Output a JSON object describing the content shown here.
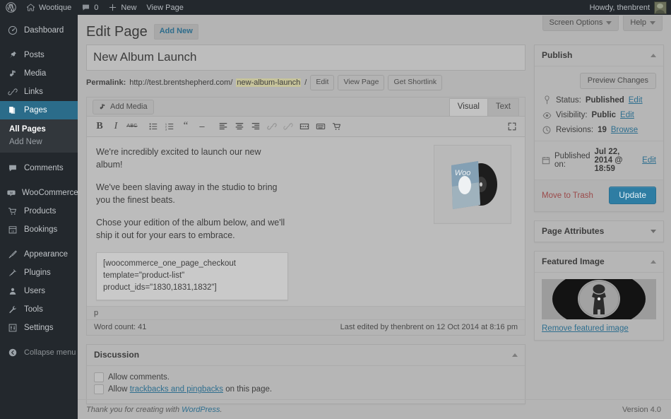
{
  "adminbar": {
    "logo_icon": "wordpress-logo-icon",
    "site_name": "Wootique",
    "site_icon": "home-icon",
    "comments_icon": "comment-bubble-icon",
    "comments_count": "0",
    "new_icon": "plus-icon",
    "new_label": "New",
    "view_page_label": "View Page",
    "howdy": "Howdy, thenbrent",
    "avatar_name": "user-avatar"
  },
  "sidebar": {
    "items": [
      {
        "label": "Dashboard",
        "icon": "dashboard-icon",
        "key": "dashboard",
        "current": false
      },
      {
        "label": "Posts",
        "icon": "pin-icon",
        "key": "posts",
        "current": false
      },
      {
        "label": "Media",
        "icon": "media-icon",
        "key": "media",
        "current": false
      },
      {
        "label": "Links",
        "icon": "link-icon",
        "key": "links",
        "current": false
      },
      {
        "label": "Pages",
        "icon": "page-icon",
        "key": "pages",
        "current": true
      },
      {
        "label": "Comments",
        "icon": "comment-bubble-icon",
        "key": "comments",
        "current": false
      },
      {
        "label": "WooCommerce",
        "icon": "woocommerce-icon",
        "key": "woocommerce",
        "current": false
      },
      {
        "label": "Products",
        "icon": "cart-icon",
        "key": "products",
        "current": false
      },
      {
        "label": "Bookings",
        "icon": "calendar-icon",
        "key": "bookings",
        "current": false
      },
      {
        "label": "Appearance",
        "icon": "brush-icon",
        "key": "appearance",
        "current": false
      },
      {
        "label": "Plugins",
        "icon": "plug-icon",
        "key": "plugins",
        "current": false
      },
      {
        "label": "Users",
        "icon": "user-icon",
        "key": "users",
        "current": false
      },
      {
        "label": "Tools",
        "icon": "wrench-icon",
        "key": "tools",
        "current": false
      },
      {
        "label": "Settings",
        "icon": "settings-icon",
        "key": "settings",
        "current": false
      }
    ],
    "submenu": {
      "all_pages": "All Pages",
      "add_new": "Add New"
    },
    "collapse": {
      "label": "Collapse menu",
      "icon": "collapse-arrow-icon"
    },
    "active_color": "#2b6c8a"
  },
  "screen_meta": {
    "screen_options": "Screen Options",
    "help": "Help"
  },
  "header": {
    "title": "Edit Page",
    "add_new": "Add New"
  },
  "post": {
    "title": "New Album Launch",
    "title_placeholder": "Enter title here",
    "permalink": {
      "label": "Permalink:",
      "base_url": "http://test.brentshepherd.com/",
      "slug": "new-album-launch",
      "slug_suffix": "/",
      "edit_button": "Edit",
      "view_button": "View Page",
      "shortlink_button": "Get Shortlink"
    },
    "editor": {
      "add_media": "Add Media",
      "add_media_icon": "add-media-icon",
      "tabs": [
        {
          "label": "Visual",
          "active": true
        },
        {
          "label": "Text",
          "active": false
        }
      ],
      "toolbar": [
        {
          "name": "bold-icon",
          "glyph": "B"
        },
        {
          "name": "italic-icon",
          "glyph": "I"
        },
        {
          "name": "strikethrough-icon",
          "glyph": "ABC"
        },
        {
          "name": "bulleted-list-icon",
          "glyph": ""
        },
        {
          "name": "numbered-list-icon",
          "glyph": ""
        },
        {
          "name": "blockquote-icon",
          "glyph": "“"
        },
        {
          "name": "horizontal-rule-icon",
          "glyph": "—"
        },
        {
          "name": "align-left-icon",
          "glyph": ""
        },
        {
          "name": "align-center-icon",
          "glyph": ""
        },
        {
          "name": "align-right-icon",
          "glyph": ""
        },
        {
          "name": "insert-link-icon",
          "glyph": ""
        },
        {
          "name": "unlink-icon",
          "glyph": ""
        },
        {
          "name": "read-more-icon",
          "glyph": ""
        },
        {
          "name": "kitchen-sink-icon",
          "glyph": ""
        },
        {
          "name": "woocommerce-shortcode-cart-icon",
          "glyph": ""
        }
      ],
      "fullscreen_icon": "distraction-free-icon",
      "paragraphs": [
        "We're incredibly excited to launch our new album!",
        "We've been slaving away in the studio to bring you the finest beats.",
        "Chose your edition of the album below, and we'll ship it out for your ears to embrace."
      ],
      "shortcode": "[woocommerce_one_page_checkout template=\"product-list\" product_ids=\"1830,1831,1832\"]",
      "inline_image_alt": "album-cover-woo-vinyl",
      "inline_image_label": "Woo",
      "path": "p",
      "word_count": "Word count: 41",
      "last_edited": "Last edited by thenbrent on 12 Oct 2014 at 8:16 pm"
    },
    "discussion": {
      "title": "Discussion",
      "allow_comments": "Allow comments.",
      "allow_trackbacks_prefix": "Allow ",
      "allow_trackbacks_link": "trackbacks and pingbacks",
      "allow_trackbacks_suffix": " on this page.",
      "comments_checked": false,
      "trackbacks_checked": false
    }
  },
  "publish": {
    "title": "Publish",
    "preview_button": "Preview Changes",
    "status_icon": "pin-marker-icon",
    "status_label": "Status:",
    "status_value": "Published",
    "status_edit": "Edit",
    "visibility_icon": "eye-icon",
    "visibility_label": "Visibility:",
    "visibility_value": "Public",
    "visibility_edit": "Edit",
    "revisions_icon": "clock-icon",
    "revisions_label": "Revisions:",
    "revisions_value": "19",
    "revisions_browse": "Browse",
    "published_icon": "calendar-icon",
    "published_label": "Published on:",
    "published_value": "Jul 22, 2014 @ 18:59",
    "published_edit": "Edit",
    "trash": "Move to Trash",
    "update_button": "Update",
    "update_color": "#2e7da3"
  },
  "page_attributes": {
    "title": "Page Attributes"
  },
  "featured_image": {
    "title": "Featured Image",
    "thumb_alt": "featured-vinyl-record",
    "remove_link": "Remove featured image"
  },
  "footer": {
    "thanks_prefix": "Thank you for creating with ",
    "wordpress_link": "WordPress",
    "thanks_suffix": ".",
    "version": "Version 4.0"
  }
}
